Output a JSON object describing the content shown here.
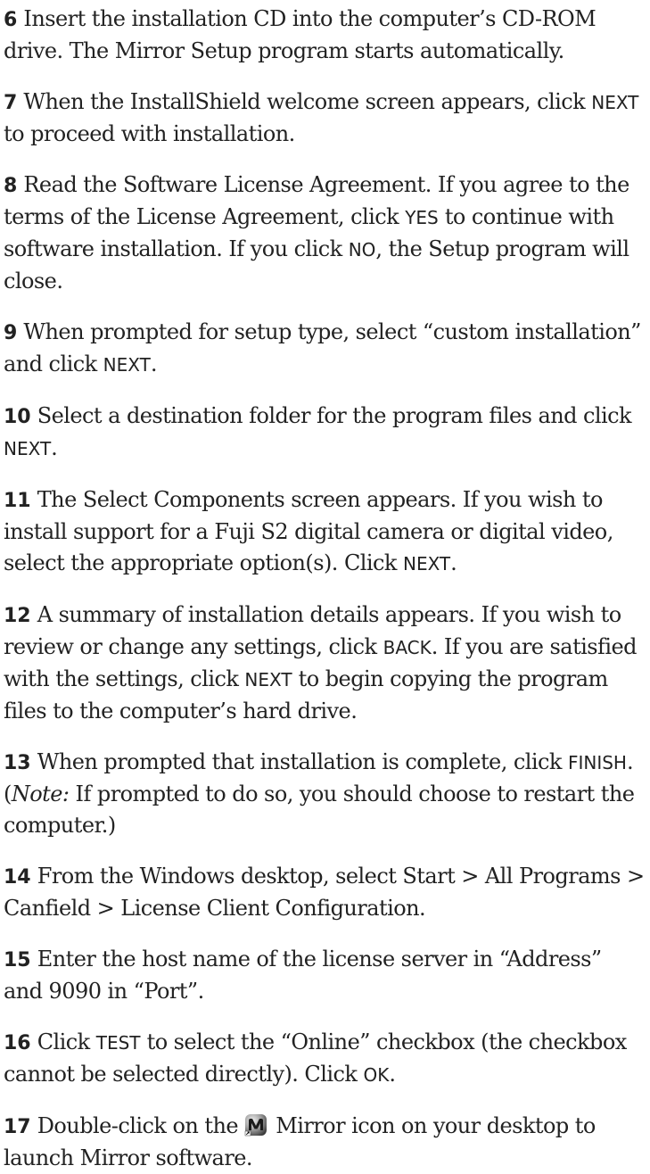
{
  "steps": [
    {
      "num": "6",
      "segments": [
        {
          "t": "Insert the installation CD into the computer’s CD-ROM drive. The Mirror Setup program starts automatically."
        }
      ]
    },
    {
      "num": "7",
      "segments": [
        {
          "t": "When the InstallShield welcome screen appears, click "
        },
        {
          "ui": "NEXT"
        },
        {
          "t": " to proceed with installation."
        }
      ]
    },
    {
      "num": "8",
      "segments": [
        {
          "t": "Read the Software License Agreement. If you agree to the terms of the License Agreement, click "
        },
        {
          "ui": "YES"
        },
        {
          "t": " to continue with software installation. If you click "
        },
        {
          "ui": "NO"
        },
        {
          "t": ", the Setup program will close."
        }
      ]
    },
    {
      "num": "9",
      "segments": [
        {
          "t": "When prompted for setup type, select “custom installation” and click "
        },
        {
          "ui": "NEXT"
        },
        {
          "t": "."
        }
      ]
    },
    {
      "num": "10",
      "segments": [
        {
          "t": "Select a destination folder for the program files and click "
        },
        {
          "ui": "NEXT"
        },
        {
          "t": "."
        }
      ]
    },
    {
      "num": "11",
      "segments": [
        {
          "t": "The Select Components screen appears. If you wish to install support for a Fuji S2 digital camera or digital video, select the appropriate option(s). Click "
        },
        {
          "ui": "NEXT"
        },
        {
          "t": "."
        }
      ]
    },
    {
      "num": "12",
      "segments": [
        {
          "t": "A summary of installation details appears. If you wish to review or change any settings, click "
        },
        {
          "ui": "BACK"
        },
        {
          "t": ". If you are satisfied with the settings, click "
        },
        {
          "ui": "NEXT"
        },
        {
          "t": " to begin copying the program files to the computer’s hard drive."
        }
      ]
    },
    {
      "num": "13",
      "segments": [
        {
          "t": "When prompted that installation is complete, click "
        },
        {
          "ui": "FINISH"
        },
        {
          "t": ". ("
        },
        {
          "em": "Note:"
        },
        {
          "t": " If prompted to do so, you should choose to restart the computer.)"
        }
      ]
    },
    {
      "num": "14",
      "segments": [
        {
          "t": "From the Windows desktop, select Start > All Programs > Canfield > License Client Configuration."
        }
      ]
    },
    {
      "num": "15",
      "segments": [
        {
          "t": "Enter the host name of the license server in “Address” and 9090 in “Port”."
        }
      ]
    },
    {
      "num": "16",
      "segments": [
        {
          "t": "Click "
        },
        {
          "ui": "TEST"
        },
        {
          "t": " to select the “Online” checkbox (the checkbox cannot be selected directly). Click "
        },
        {
          "ui": "OK"
        },
        {
          "t": "."
        }
      ]
    },
    {
      "num": "17",
      "segments": [
        {
          "t": "Double-click on the "
        },
        {
          "icon": "mirror-app-icon"
        },
        {
          "t": " Mirror icon on your desktop to launch Mirror software."
        }
      ]
    }
  ]
}
